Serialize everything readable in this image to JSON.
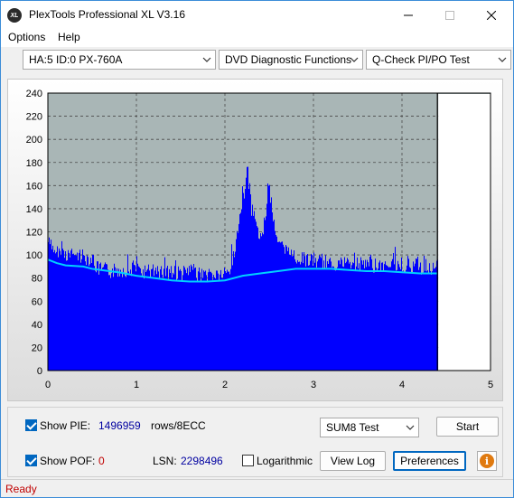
{
  "window": {
    "title": "PlexTools Professional XL V3.16",
    "icon_text": "XL"
  },
  "menu": {
    "options": "Options",
    "help": "Help"
  },
  "toolbar": {
    "drive": "HA:5 ID:0  PX-760A",
    "function": "DVD Diagnostic Functions",
    "test": "Q-Check PI/PO Test"
  },
  "chart_data": {
    "type": "area",
    "title": "",
    "xlabel": "",
    "ylabel": "",
    "xlim": [
      0,
      5
    ],
    "ylim": [
      0,
      240
    ],
    "x_ticks": [
      "0",
      "1",
      "2",
      "3",
      "4",
      "5"
    ],
    "y_ticks": [
      "0",
      "20",
      "40",
      "60",
      "80",
      "100",
      "120",
      "140",
      "160",
      "180",
      "200",
      "220",
      "240"
    ],
    "grid": true,
    "data_end_x": 4.4,
    "series": [
      {
        "kind": "PIE",
        "color": "#0000ff",
        "x": [
          0.0,
          0.05,
          0.1,
          0.2,
          0.3,
          0.4,
          0.5,
          0.55,
          0.6,
          0.7,
          0.8,
          0.9,
          1.0,
          1.1,
          1.2,
          1.3,
          1.4,
          1.5,
          1.6,
          1.7,
          1.8,
          1.9,
          2.0,
          2.05,
          2.1,
          2.15,
          2.2,
          2.25,
          2.3,
          2.35,
          2.4,
          2.45,
          2.5,
          2.55,
          2.6,
          2.7,
          2.8,
          2.9,
          3.0,
          3.2,
          3.4,
          3.6,
          3.8,
          4.0,
          4.2,
          4.4
        ],
        "values": [
          118,
          112,
          110,
          108,
          106,
          105,
          104,
          95,
          94,
          93,
          94,
          95,
          93,
          92,
          94,
          93,
          92,
          91,
          92,
          90,
          90,
          90,
          90,
          94,
          110,
          130,
          155,
          180,
          145,
          135,
          120,
          140,
          165,
          135,
          118,
          108,
          105,
          103,
          102,
          100,
          100,
          99,
          98,
          98,
          97,
          96
        ]
      },
      {
        "kind": "PIE avg",
        "color": "#00d0ff",
        "x": [
          0.0,
          0.1,
          0.2,
          0.4,
          0.5,
          0.6,
          0.8,
          1.0,
          1.2,
          1.4,
          1.6,
          1.8,
          2.0,
          2.2,
          2.4,
          2.6,
          2.8,
          3.0,
          3.2,
          3.4,
          3.6,
          3.8,
          4.0,
          4.2,
          4.4
        ],
        "values": [
          96,
          93,
          91,
          90,
          88,
          87,
          85,
          82,
          80,
          78,
          77,
          77,
          78,
          82,
          84,
          86,
          88,
          88,
          88,
          87,
          86,
          86,
          85,
          84,
          84
        ]
      }
    ]
  },
  "panel": {
    "show_pie_label": "Show PIE:",
    "pie_value": "1496959",
    "pie_unit": "rows/8ECC",
    "show_pof_label": "Show POF:",
    "pof_value": "0",
    "lsn_label": "LSN:",
    "lsn_value": "2298496",
    "logarithmic_label": "Logarithmic",
    "test_select": "SUM8 Test",
    "start_button": "Start",
    "view_log_button": "View Log",
    "preferences_button": "Preferences"
  },
  "status": {
    "text": "Ready"
  }
}
